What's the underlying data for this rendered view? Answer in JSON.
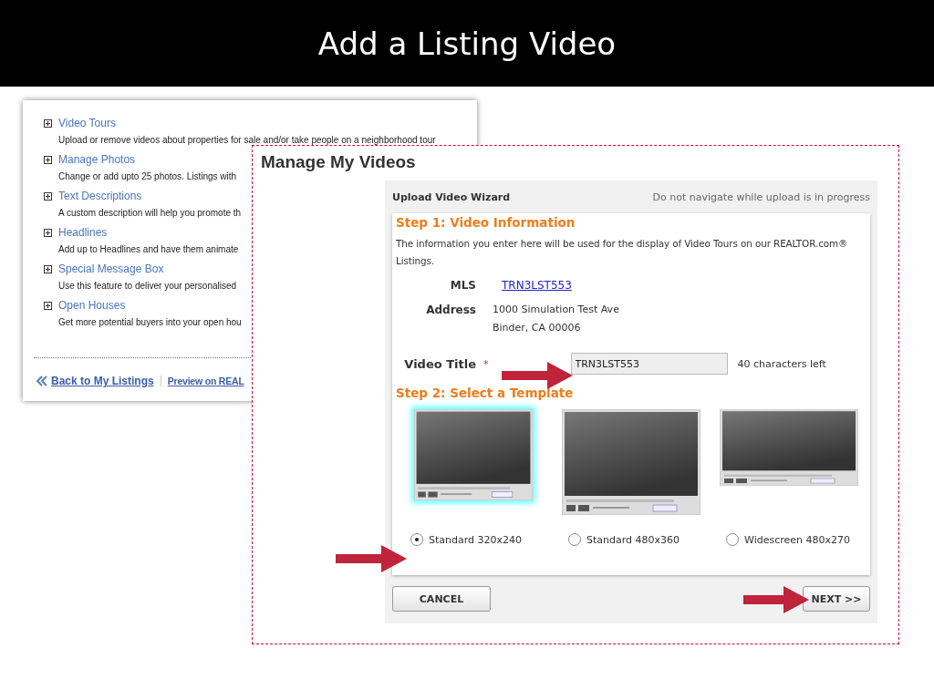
{
  "slide_title": "Add a Listing Video",
  "back_page": {
    "sections": [
      {
        "title": "Video Tours",
        "description": "Upload or remove videos about properties for sale and/or take people on a neighborhood tour"
      },
      {
        "title": "Manage Photos",
        "description": "Change or add upto 25 photos. Listings with"
      },
      {
        "title": "Text Descriptions",
        "description": "A custom description will help you promote th"
      },
      {
        "title": "Headlines",
        "description": "Add up to Headlines and have them animate"
      },
      {
        "title": "Special Message Box",
        "description": "Use this feature to deliver your personalised"
      },
      {
        "title": "Open Houses",
        "description": "Get more potential buyers into your open hou"
      }
    ],
    "links": [
      "Back to My Listings",
      "Preview on REAL"
    ]
  },
  "page_title": "Manage My Videos",
  "wizard": {
    "title": "Upload Video Wizard",
    "notice": "Do not navigate while upload is in progress",
    "step1": {
      "heading": "Step 1: Video Information",
      "intro": "The information you enter here will be used for the display of Video Tours on our REALTOR.com® Listings.",
      "mls_label": "MLS",
      "mls_value": "TRN3LST553",
      "address_label": "Address",
      "address_lines": [
        "1000 Simulation Test Ave",
        "Binder, CA 00006"
      ],
      "title_label": "Video Title",
      "required_mark": "*",
      "title_value": "TRN3LST553",
      "chars_left": "40 characters left"
    },
    "step2": {
      "heading": "Step 2: Select a Template",
      "templates": [
        {
          "label": "Standard 320x240",
          "kind": "standard",
          "selected": true
        },
        {
          "label": "Standard 480x360",
          "kind": "standard",
          "selected": false
        },
        {
          "label": "Widescreen 480x270",
          "kind": "wide",
          "selected": false
        }
      ]
    },
    "buttons": {
      "cancel": "CANCEL",
      "next": "NEXT >>"
    }
  }
}
